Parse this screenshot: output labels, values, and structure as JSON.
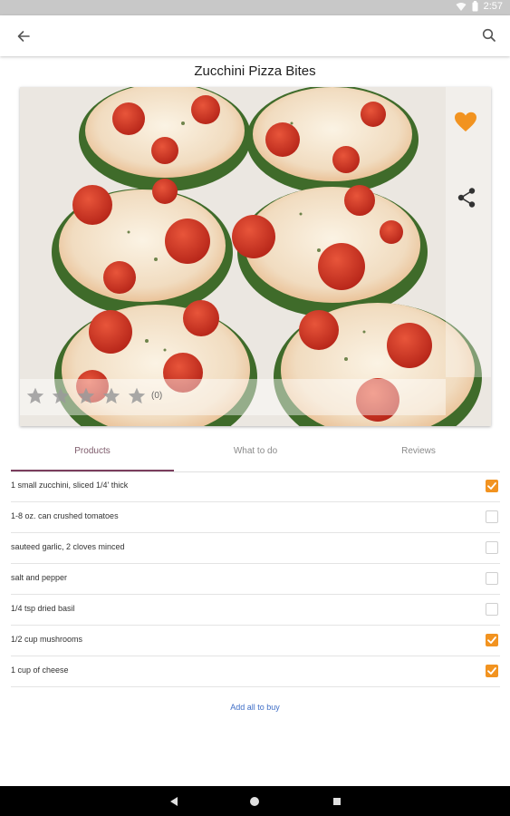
{
  "status_bar": {
    "time": "2:57"
  },
  "recipe": {
    "title": "Zucchini Pizza Bites",
    "rating_count": "(0)",
    "rating_value": 0,
    "rating_max": 5,
    "favorited": true
  },
  "tabs": [
    {
      "label": "Products",
      "active": true
    },
    {
      "label": "What to do",
      "active": false
    },
    {
      "label": "Reviews",
      "active": false
    }
  ],
  "ingredients": [
    {
      "label": "1 small zucchini, sliced 1/4' thick",
      "checked": true
    },
    {
      "label": "1-8 oz. can crushed tomatoes",
      "checked": false
    },
    {
      "label": "sauteed garlic, 2 cloves minced",
      "checked": false
    },
    {
      "label": "salt and pepper",
      "checked": false
    },
    {
      "label": "1/4 tsp dried basil",
      "checked": false
    },
    {
      "label": "1/2 cup mushrooms",
      "checked": true
    },
    {
      "label": "1 cup of cheese",
      "checked": true
    }
  ],
  "add_all_label": "Add all to buy",
  "colors": {
    "accent": "#f29320",
    "tab_underline": "#7a3d5d",
    "link": "#3f6ec7"
  },
  "icons": {
    "back": "arrow-left-icon",
    "search": "search-icon",
    "favorite": "heart-icon",
    "share": "share-icon",
    "star": "star-icon",
    "nav_back": "triangle-back-icon",
    "nav_home": "circle-home-icon",
    "nav_recents": "square-recents-icon"
  }
}
